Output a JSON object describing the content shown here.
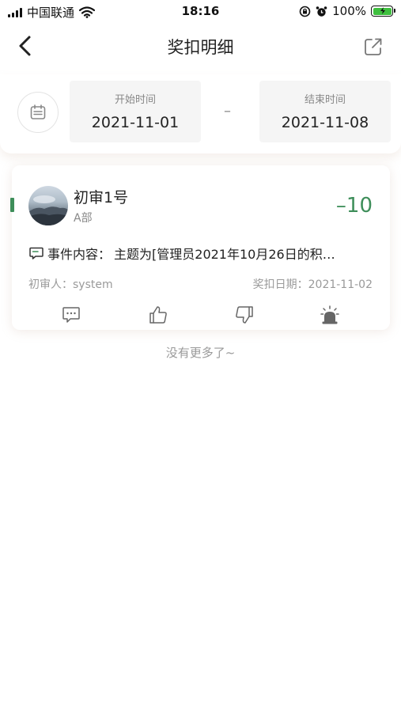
{
  "status_bar": {
    "carrier": "中国联通",
    "time": "18:16",
    "battery": "100%",
    "icons": [
      "signal-icon",
      "wifi-icon",
      "orientation-lock-icon",
      "alarm-icon",
      "battery-charging-icon"
    ]
  },
  "nav": {
    "title": "奖扣明细",
    "back_icon": "back-arrow-icon",
    "share_icon": "share-export-icon"
  },
  "date_range": {
    "calendar_icon": "calendar-icon",
    "start_label": "开始时间",
    "start_value": "2021-11-01",
    "separator": "–",
    "end_label": "结束时间",
    "end_value": "2021-11-08"
  },
  "records": [
    {
      "name": "初审1号",
      "dept": "A部",
      "score": "–10",
      "event_label": "事件内容：",
      "event_text": "主题为[管理员2021年10月26日的积…",
      "reviewer": "初审人：system",
      "date": "奖扣日期：2021-11-02",
      "actions": [
        "comment-icon",
        "thumbs-up-icon",
        "thumbs-down-icon",
        "siren-alarm-icon"
      ]
    }
  ],
  "footer": {
    "no_more": "没有更多了~"
  },
  "colors": {
    "accent_green": "#3e8e5a",
    "muted_text": "#9a9a9a",
    "date_box_bg": "#f5f5f5"
  }
}
